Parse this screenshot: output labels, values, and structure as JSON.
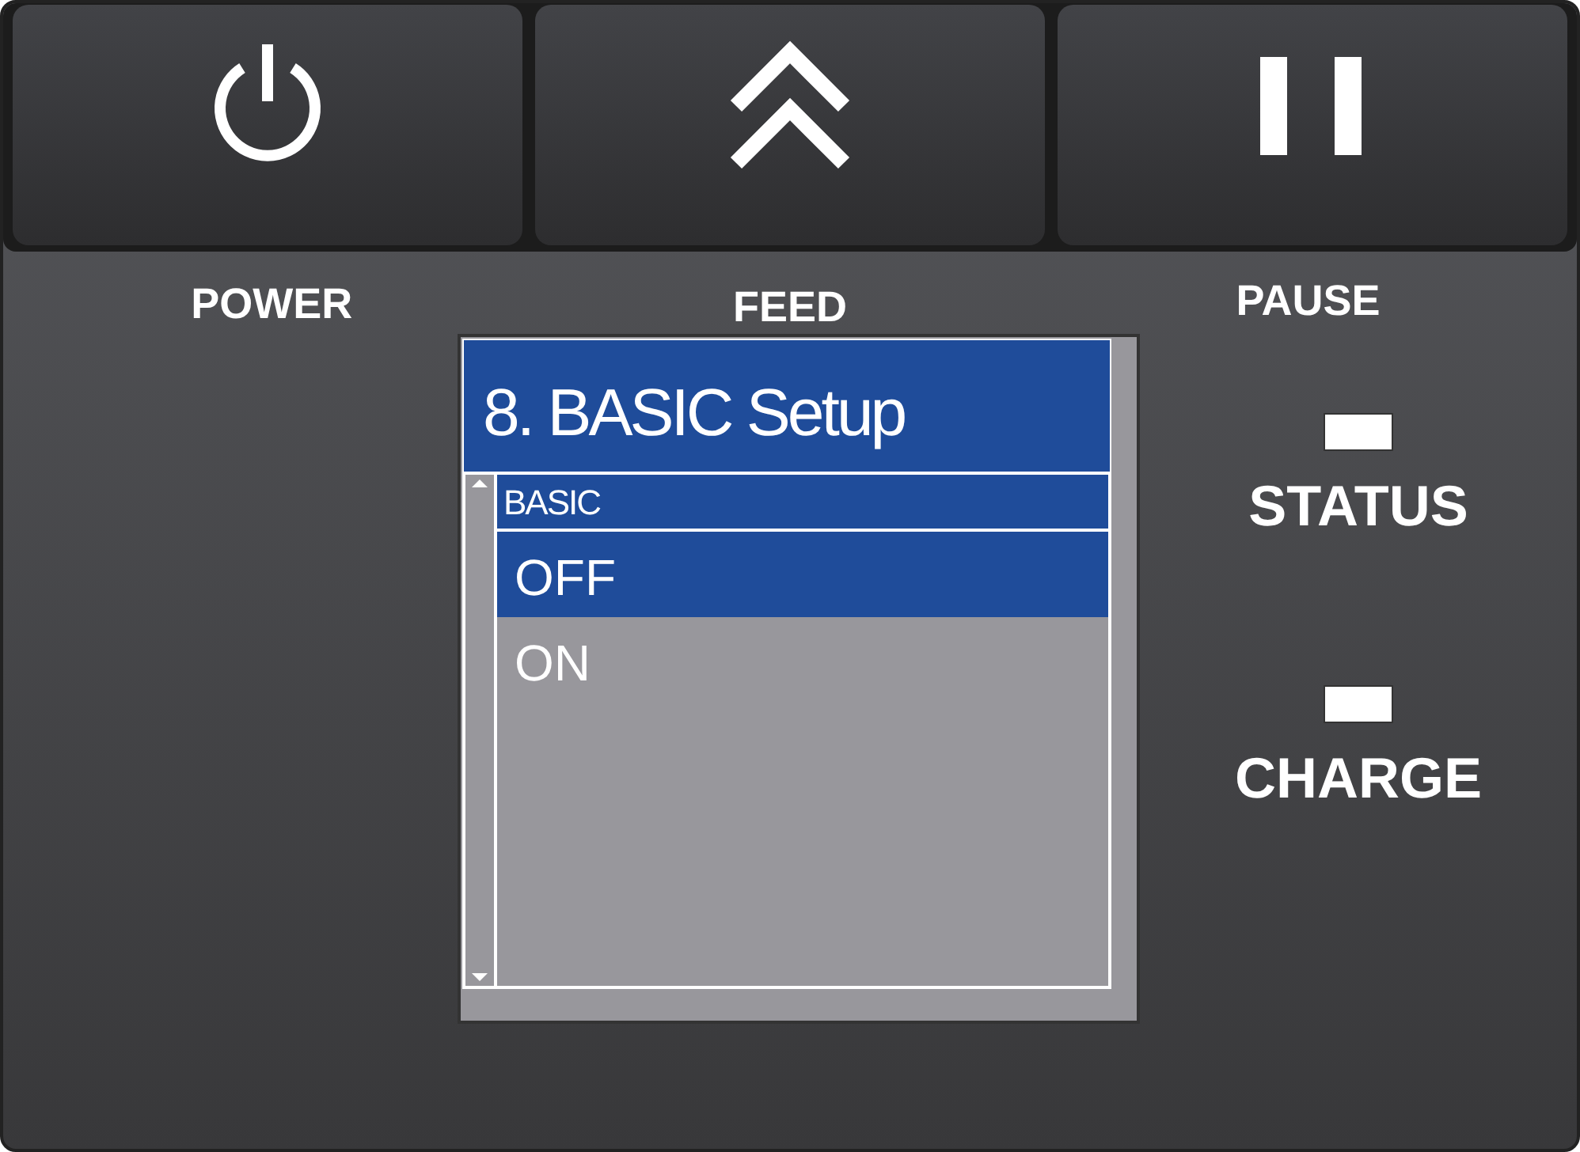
{
  "buttons": [
    {
      "kind": "power",
      "label": "POWER"
    },
    {
      "kind": "feed",
      "label": "FEED"
    },
    {
      "kind": "pause",
      "label": "PAUSE"
    }
  ],
  "screen": {
    "title": "8. BASIC Setup",
    "header": "BASIC",
    "options": [
      {
        "label": "OFF",
        "selected": true
      },
      {
        "label": "ON",
        "selected": false
      }
    ]
  },
  "indicators": [
    {
      "label": "STATUS"
    },
    {
      "label": "CHARGE"
    }
  ]
}
